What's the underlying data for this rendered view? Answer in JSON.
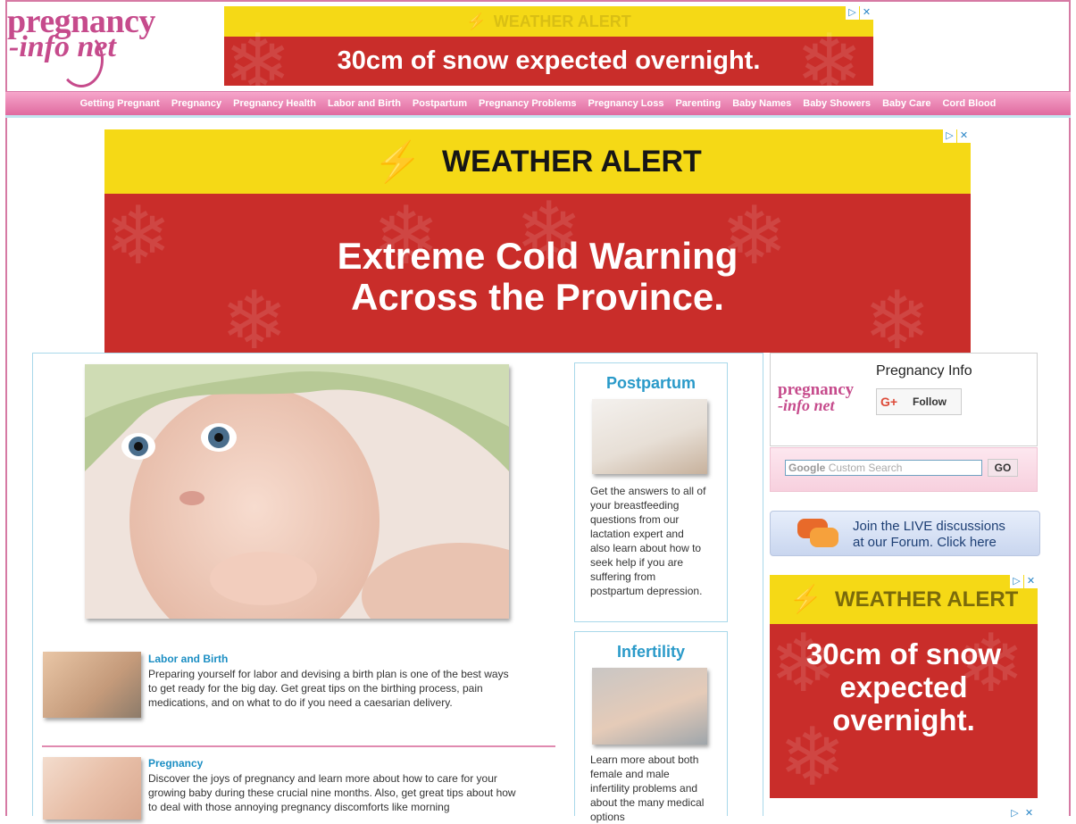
{
  "logo": {
    "line1": "pregnancy",
    "line2": "-info net"
  },
  "top_ad": {
    "band": "WEATHER ALERT",
    "message": "30cm of snow expected overnight."
  },
  "nav": [
    "Getting Pregnant",
    "Pregnancy",
    "Pregnancy Health",
    "Labor and Birth",
    "Postpartum",
    "Pregnancy Problems",
    "Pregnancy Loss",
    "Parenting",
    "Baby Names",
    "Baby Showers",
    "Baby Care",
    "Cord Blood"
  ],
  "banner_ad": {
    "band": "WEATHER ALERT",
    "line1": "Extreme Cold Warning",
    "line2": "Across the Province."
  },
  "entries": [
    {
      "title": "Labor and Birth",
      "text": "Preparing yourself for labor and devising a birth plan is one of the best ways to get ready for the big day. Get great tips on the birthing process, pain medications, and on what to do if you need a caesarian delivery."
    },
    {
      "title": "Pregnancy",
      "text": "Discover the joys of pregnancy and learn more about how to care for your growing baby during these crucial nine months. Also, get great tips about how to deal with those annoying pregnancy discomforts like morning"
    }
  ],
  "sidebar_boxes": [
    {
      "title": "Postpartum",
      "text": "Get the answers to all of your breastfeeding questions from our lactation expert and also learn about how to seek help if you are suffering from postpartum depression."
    },
    {
      "title": "Infertility",
      "text": "Learn more about both female and male infertility problems and about the many medical options"
    }
  ],
  "gplus": {
    "name": "Pregnancy Info",
    "follow": "Follow",
    "logo1": "pregnancy",
    "logo2": "-info net"
  },
  "search": {
    "placeholder": "Custom Search",
    "brand": "Google",
    "go": "GO"
  },
  "forum": {
    "line1": "Join the LIVE discussions",
    "line2": "at our Forum. Click here"
  },
  "side_ad": {
    "band": "WEATHER ALERT",
    "message": "30cm of snow expected overnight."
  },
  "colors": {
    "pink": "#c64b8c",
    "nav": "#e06a9f",
    "link": "#2a9ac9",
    "alert_red": "#c92d2a",
    "alert_yellow": "#f5d916"
  }
}
